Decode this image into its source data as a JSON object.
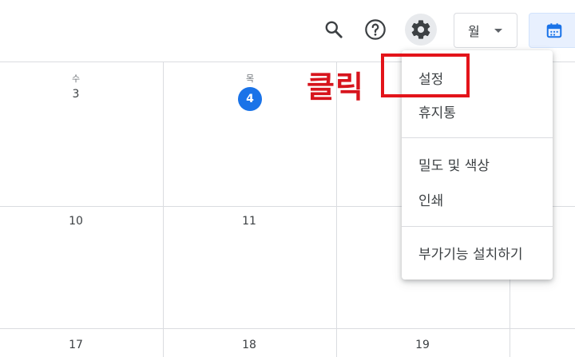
{
  "header": {
    "view_select": {
      "label": "월"
    }
  },
  "calendar": {
    "week1": [
      {
        "dow": "수",
        "day": "3",
        "today": false
      },
      {
        "dow": "목",
        "day": "4",
        "today": true
      }
    ],
    "week2": [
      "10",
      "11"
    ],
    "week3": [
      "17",
      "18",
      "19"
    ]
  },
  "annotation": {
    "label": "클릭"
  },
  "settings_menu": {
    "items": [
      "설정",
      "휴지통",
      "밀도 및 색상",
      "인쇄",
      "부가기능 설치하기"
    ]
  },
  "colors": {
    "today": "#1a73e8",
    "annotation": "#e3141a",
    "active_view": "#e8f0fe"
  }
}
